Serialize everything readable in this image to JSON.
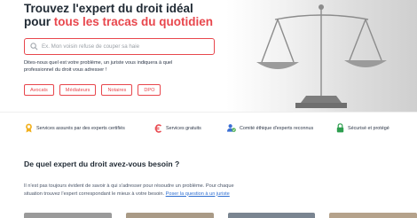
{
  "hero": {
    "title_line1": "Trouvez l'expert du droit idéal",
    "title_line2_prefix": "pour ",
    "title_line2_accent": "tous les tracas du quotidien",
    "search_placeholder": "Ex. Mon voisin refuse de couper sa haie",
    "intro": "Dites-nous quel est votre problème, un juriste vous indiquera à quel professionnel du droit vous adresser !",
    "chips": [
      "Avocats",
      "Médiateurs",
      "Notaires",
      "DPO"
    ],
    "accent_color": "#e8474d"
  },
  "features": [
    {
      "icon": "certified-ribbon-icon",
      "label": "Services assurés par des experts certifiés"
    },
    {
      "icon": "euro-icon",
      "label": "Services gratuits"
    },
    {
      "icon": "user-check-icon",
      "label": "Comité éthique d'experts reconnus"
    },
    {
      "icon": "lock-icon",
      "label": "Sécurisé et protégé"
    }
  ],
  "section": {
    "title": "De quel expert du droit avez-vous besoin ?",
    "text_line1": "Il n'est pas toujours évident de savoir à qui s'adresser pour résoudre un problème. Pour chaque",
    "text_line2": "situation trouvez l'expert correspondant le mieux à votre besoin. ",
    "link": "Poser la question à un juriste"
  }
}
